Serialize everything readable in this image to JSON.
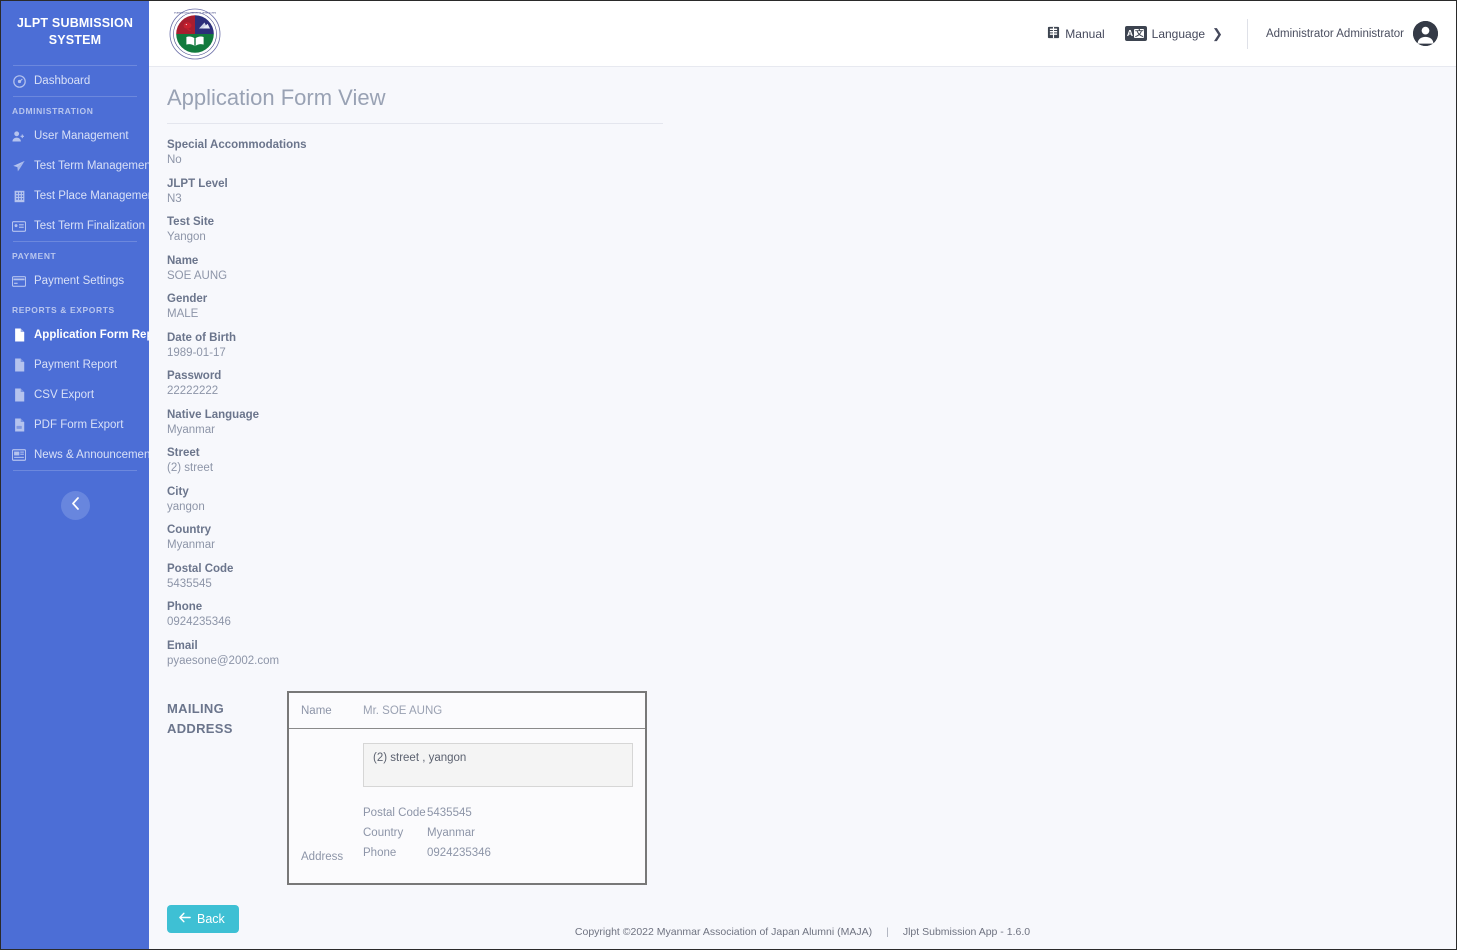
{
  "sidebar": {
    "brand_line1": "JLPT SUBMISSION",
    "brand_line2": "SYSTEM",
    "dashboard": {
      "label": "Dashboard",
      "icon": "dashboard-icon"
    },
    "sections": [
      {
        "header": "ADMINISTRATION",
        "items": [
          {
            "label": "User Management",
            "icon": "user-plus-icon"
          },
          {
            "label": "Test Term Management",
            "icon": "paper-plane-icon"
          },
          {
            "label": "Test Place Management",
            "icon": "building-icon"
          },
          {
            "label": "Test Term Finalization",
            "icon": "id-card-icon"
          }
        ]
      },
      {
        "header": "PAYMENT",
        "items": [
          {
            "label": "Payment Settings",
            "icon": "credit-card-icon"
          }
        ]
      },
      {
        "header": "REPORTS & EXPORTS",
        "items": [
          {
            "label": "Application Form Report",
            "icon": "file-icon",
            "active": true
          },
          {
            "label": "Payment Report",
            "icon": "file-icon"
          },
          {
            "label": "CSV Export",
            "icon": "file-icon"
          },
          {
            "label": "PDF Form Export",
            "icon": "file-pdf-icon"
          },
          {
            "label": "News & Announcement",
            "icon": "news-icon"
          }
        ]
      }
    ],
    "collapse_icon": "chevron-left-icon"
  },
  "topbar": {
    "logo_alt": "maja-logo",
    "manual_label": "Manual",
    "manual_icon": "book-icon",
    "language_label": "Language",
    "language_icon": "translate-icon",
    "language_chevron": "❯",
    "user_name": "Administrator Administrator",
    "avatar_icon": "user-avatar-icon"
  },
  "page": {
    "title": "Application Form View",
    "fields": [
      {
        "label": "Special Accommodations",
        "value": "No"
      },
      {
        "label": "JLPT Level",
        "value": "N3"
      },
      {
        "label": "Test Site",
        "value": "Yangon"
      },
      {
        "label": "Name",
        "value": "SOE AUNG"
      },
      {
        "label": "Gender",
        "value": "MALE"
      },
      {
        "label": "Date of Birth",
        "value": "1989-01-17"
      },
      {
        "label": "Password",
        "value": "22222222"
      },
      {
        "label": "Native Language",
        "value": "Myanmar"
      },
      {
        "label": "Street",
        "value": "(2) street"
      },
      {
        "label": "City",
        "value": "yangon"
      },
      {
        "label": "Country",
        "value": "Myanmar"
      },
      {
        "label": "Postal Code",
        "value": "5435545"
      },
      {
        "label": "Phone",
        "value": "0924235346"
      },
      {
        "label": "Email",
        "value": "pyaesone@2002.com"
      }
    ],
    "mailing": {
      "section_label_line1": "MAILING",
      "section_label_line2": "ADDRESS",
      "name_key": "Name",
      "name_value": "Mr. SOE AUNG",
      "address_key": "Address",
      "street_line": "(2) street ,  yangon",
      "rows": [
        {
          "key": "Postal Code",
          "value": "5435545"
        },
        {
          "key": "Country",
          "value": "Myanmar"
        },
        {
          "key": "Phone",
          "value": "0924235346"
        }
      ]
    },
    "back_label": "Back",
    "back_icon": "arrow-left-icon"
  },
  "footer": {
    "copyright": "Copyright ©2022 Myanmar Association of Japan Alumni (MAJA)",
    "separator": "|",
    "app_version": "Jlpt Submission App - 1.6.0"
  },
  "colors": {
    "sidebar": "#4c6ed6",
    "accent": "#3ec0d4",
    "page_bg": "#f7f8fc"
  }
}
